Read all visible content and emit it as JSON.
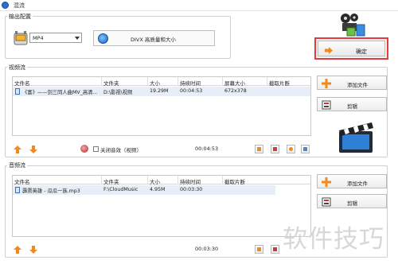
{
  "window": {
    "title": "混流"
  },
  "output": {
    "group_label": "输出配置",
    "format_value": "MP4",
    "quality_label": "DIVX 高质量和大小"
  },
  "confirm_label": "确定",
  "video": {
    "group_label": "视频流",
    "columns": [
      "文件名",
      "文件夹",
      "大小",
      "持续时间",
      "屏幕大小",
      "截取片断"
    ],
    "rows": [
      {
        "name": "《富》——剑三同人曲MV_高清...",
        "folder": "D:\\影视\\视频",
        "size": "19.29M",
        "duration": "00:04:53",
        "screen": "672x378",
        "clip": ""
      }
    ],
    "add_label": "添加文件",
    "edit_label": "剪辑",
    "mute_label": "关闭音效（视频）",
    "time": "00:04:53"
  },
  "audio": {
    "group_label": "音频流",
    "columns": [
      "文件名",
      "文件夹",
      "大小",
      "持续时间",
      "截取片断"
    ],
    "rows": [
      {
        "name": "霹雳英雄 - 瓜瓜一族.mp3",
        "folder": "F:\\CloudMusic",
        "size": "4.95M",
        "duration": "00:03:30",
        "clip": ""
      }
    ],
    "add_label": "添加文件",
    "edit_label": "剪辑",
    "time": "00:03:30"
  },
  "watermark": "软件技巧",
  "colors": {
    "highlight_border": "#e23b3b",
    "row_selected": "#e7eef8",
    "accent_orange": "#f08a1c"
  },
  "icons": [
    "app-icon",
    "format-icon",
    "quality-icon",
    "film-icon",
    "arrow-right-icon",
    "plus-icon",
    "cut-icon",
    "clapperboard-icon",
    "arrow-up-icon",
    "arrow-down-icon",
    "mute-icon"
  ]
}
